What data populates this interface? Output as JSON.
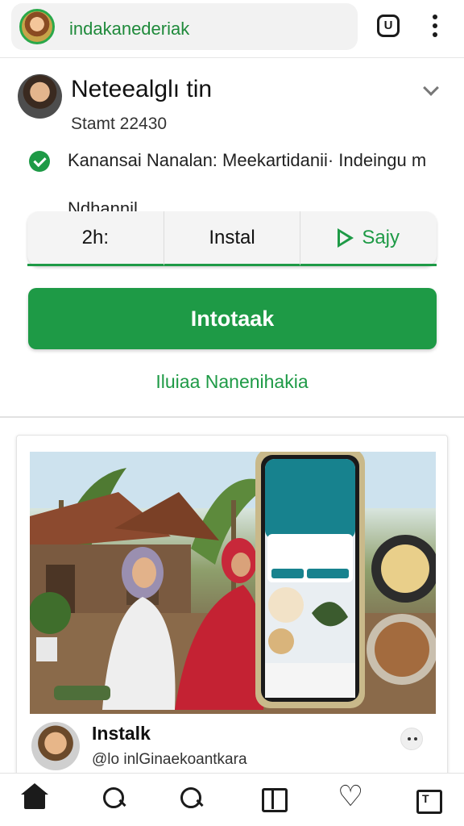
{
  "browser": {
    "url_text": "indakanederiak",
    "tabs_count": "U",
    "site_icon": "profile-logo-icon",
    "menu_icon": "vertical-dots-icon"
  },
  "app_card": {
    "title": "Neteealglı tin",
    "subtitle": "Stamt 22430",
    "features": [
      "Kanansai Nanalan: Meekartidanii· Indeingu m",
      "Ndhannil"
    ],
    "collapse_icon": "chevron-down-icon"
  },
  "segments": {
    "rating": "2h:",
    "install": "Instal",
    "play": "Sajy"
  },
  "install_button": "Intotaak",
  "secondary_link": "Iluiaa Nanenihakia",
  "post": {
    "name": "Instalk",
    "handle": "@lo inlGinaekoantkara",
    "more_icon": "more-options-icon"
  },
  "bottom_nav": [
    {
      "icon": "home-icon"
    },
    {
      "icon": "search-icon"
    },
    {
      "icon": "search-icon"
    },
    {
      "icon": "book-icon"
    },
    {
      "icon": "heart-icon"
    },
    {
      "icon": "profile-icon"
    }
  ],
  "colors": {
    "accent": "#1e9a46",
    "link": "#1f8a3b",
    "background": "#ffffff"
  }
}
